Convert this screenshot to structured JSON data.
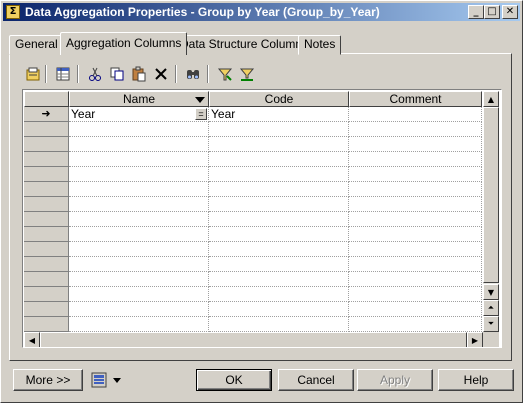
{
  "window": {
    "title": "Data Aggregation Properties - Group by Year (Group_by_Year)",
    "controls": {
      "minimize": "_",
      "maximize": "□",
      "close": "✕"
    }
  },
  "tabs": [
    {
      "label": "General",
      "active": false
    },
    {
      "label": "Aggregation Columns",
      "active": true
    },
    {
      "label": "Data Structure Columns",
      "active": false
    },
    {
      "label": "Notes",
      "active": false
    }
  ],
  "toolbar": {
    "icons": [
      "properties-icon",
      "add-columns-icon",
      "cut-icon",
      "copy-icon",
      "paste-icon",
      "delete-icon",
      "find-icon",
      "filter-icon",
      "clear-filter-icon"
    ]
  },
  "grid": {
    "columns": [
      {
        "label": "Name"
      },
      {
        "label": "Code"
      },
      {
        "label": "Comment"
      }
    ],
    "rows": [
      {
        "name": "Year",
        "code": "Year",
        "comment": "",
        "current": true
      }
    ],
    "current_marker": "➜",
    "edit_button": "="
  },
  "footer": {
    "more_label": "More >>",
    "ok_label": "OK",
    "cancel_label": "Cancel",
    "apply_label": "Apply",
    "help_label": "Help"
  },
  "colors": {
    "face": "#d4d0c8",
    "title_start": "#0a246a",
    "title_end": "#a6caf0"
  }
}
